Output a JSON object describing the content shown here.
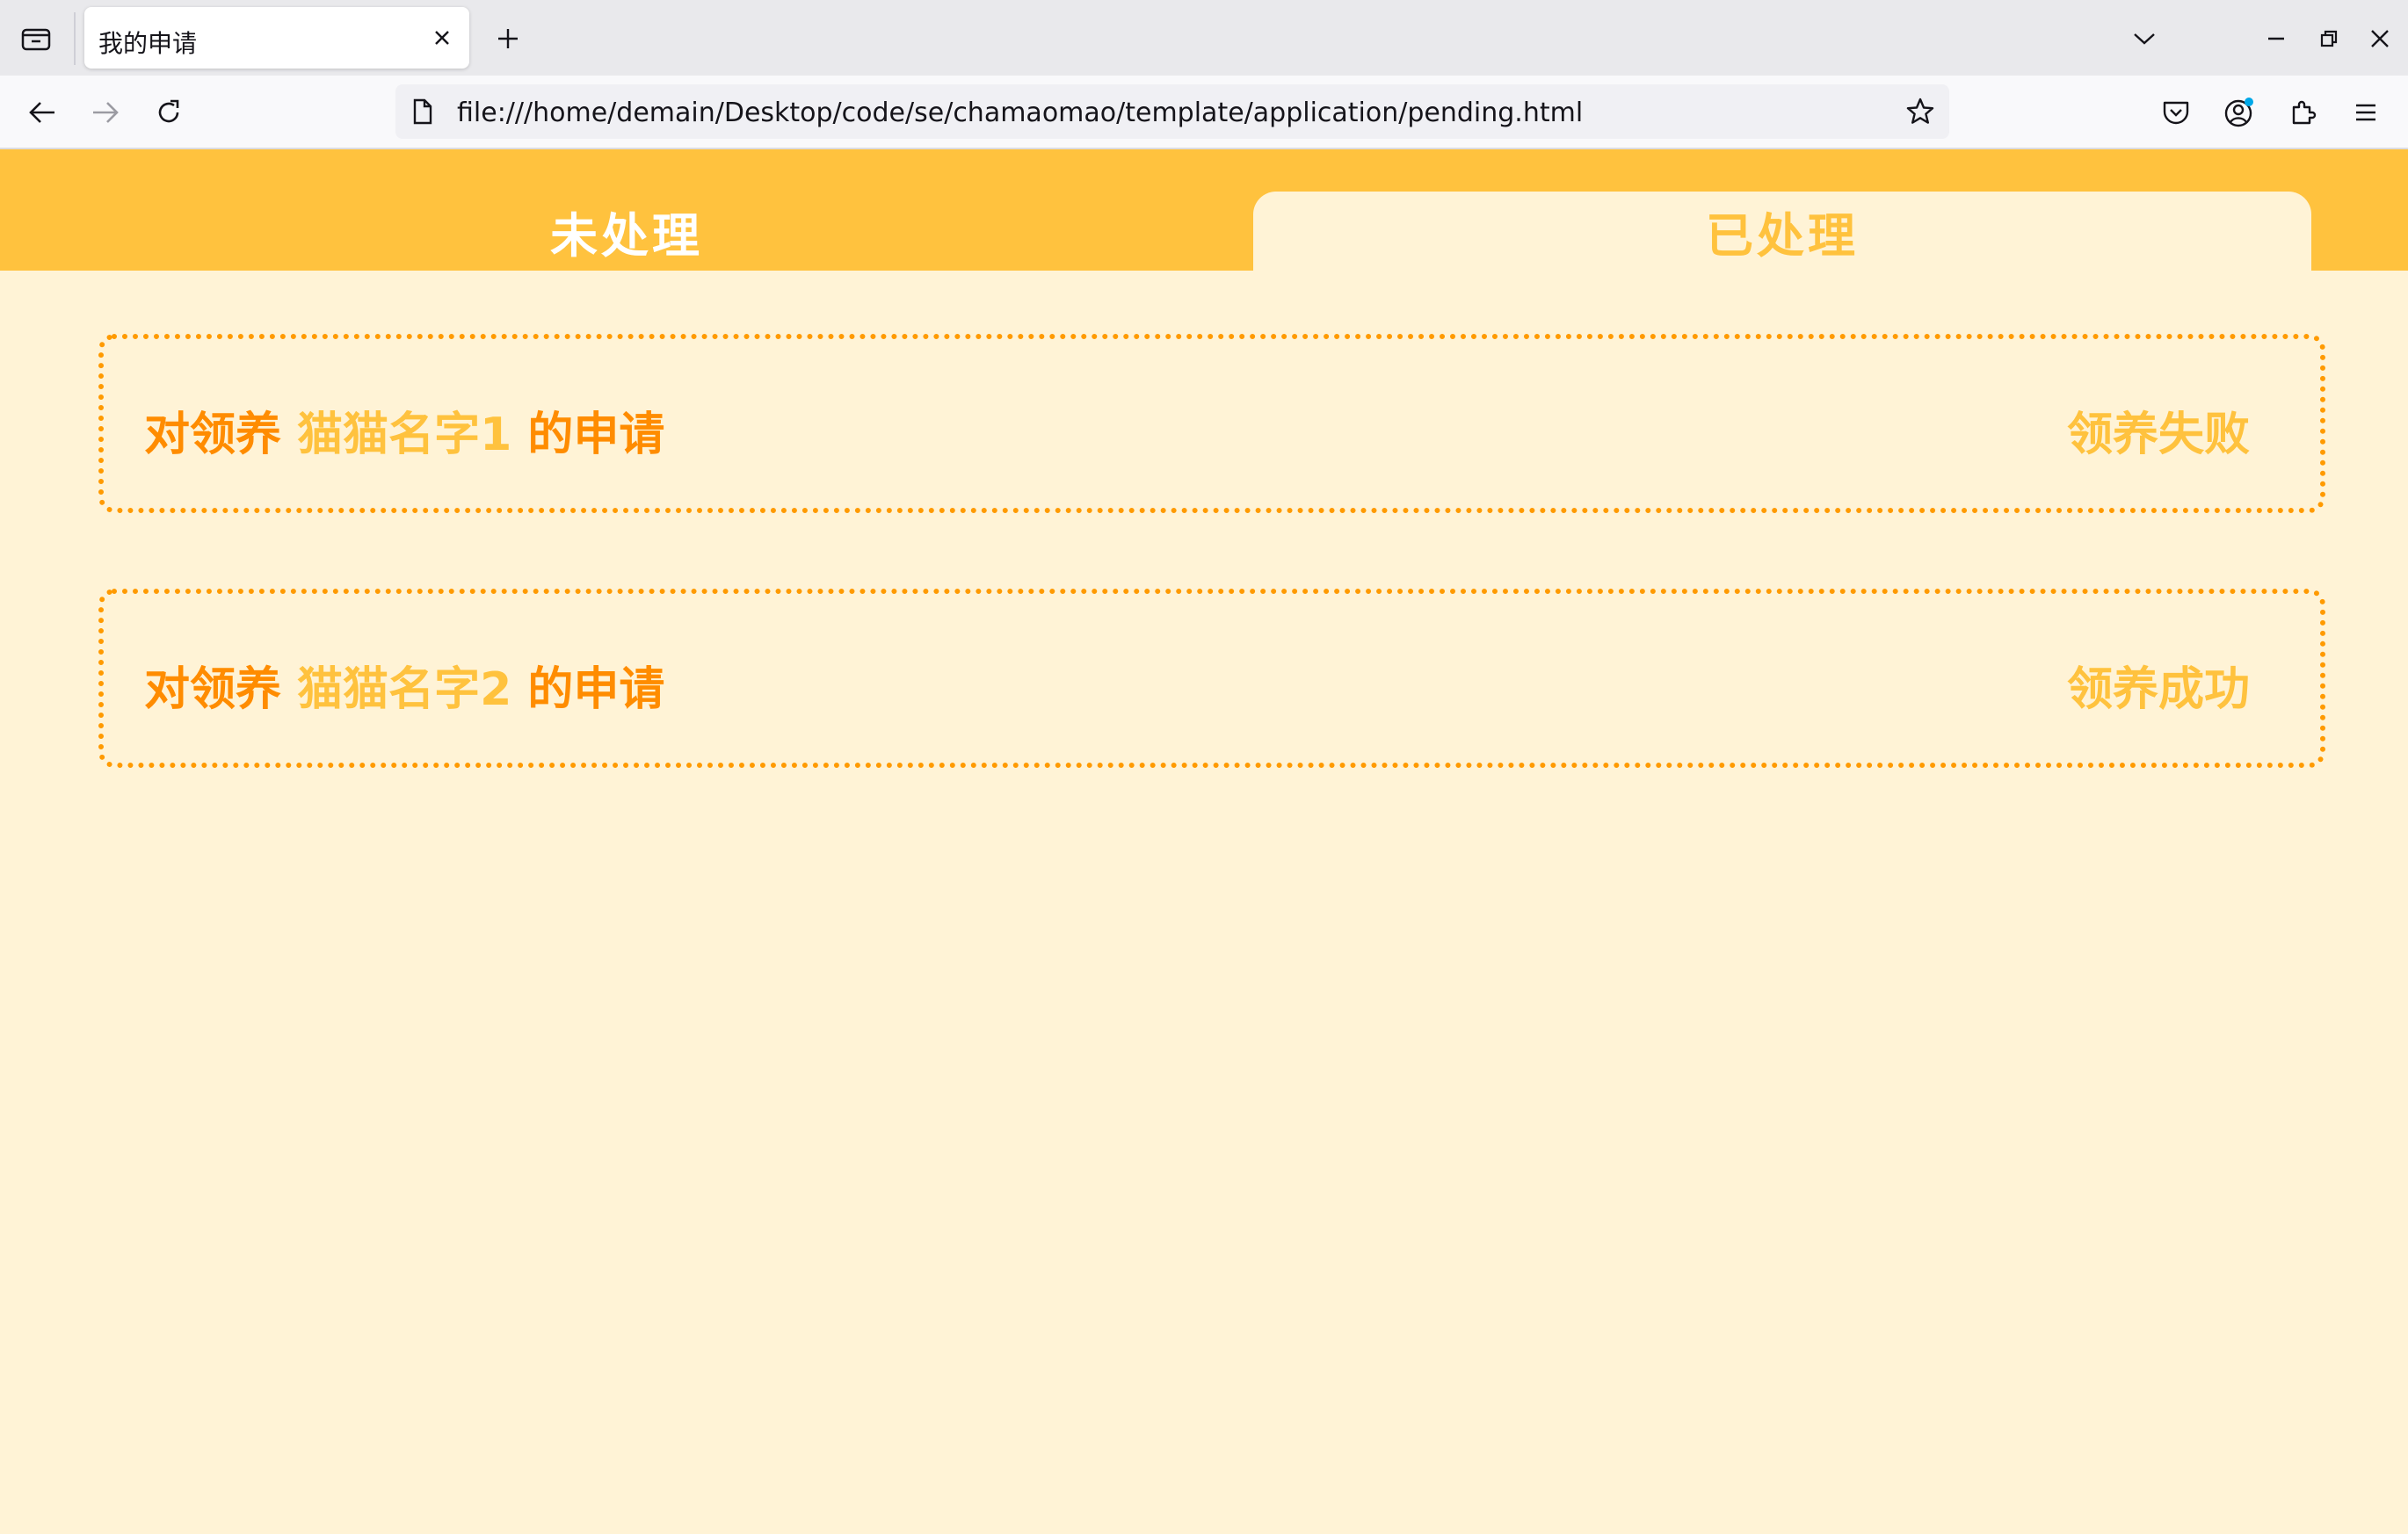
{
  "browser": {
    "tab_title": "我的申请",
    "url": "file:///home/demain/Desktop/code/se/chamaomao/template/application/pending.html"
  },
  "page": {
    "tabs": [
      {
        "label": "未处理"
      },
      {
        "label": "已处理"
      }
    ],
    "applications": [
      {
        "prefix": "对领养 ",
        "cat_name": "猫猫名字1",
        "suffix": " 的申请",
        "status": "领养失败"
      },
      {
        "prefix": "对领养 ",
        "cat_name": "猫猫名字2",
        "suffix": " 的申请",
        "status": "领养成功"
      }
    ]
  },
  "colors": {
    "header": "#ffc23e",
    "background": "#fff3d6",
    "accent": "#ff8c00",
    "highlight": "#ffc23e"
  }
}
